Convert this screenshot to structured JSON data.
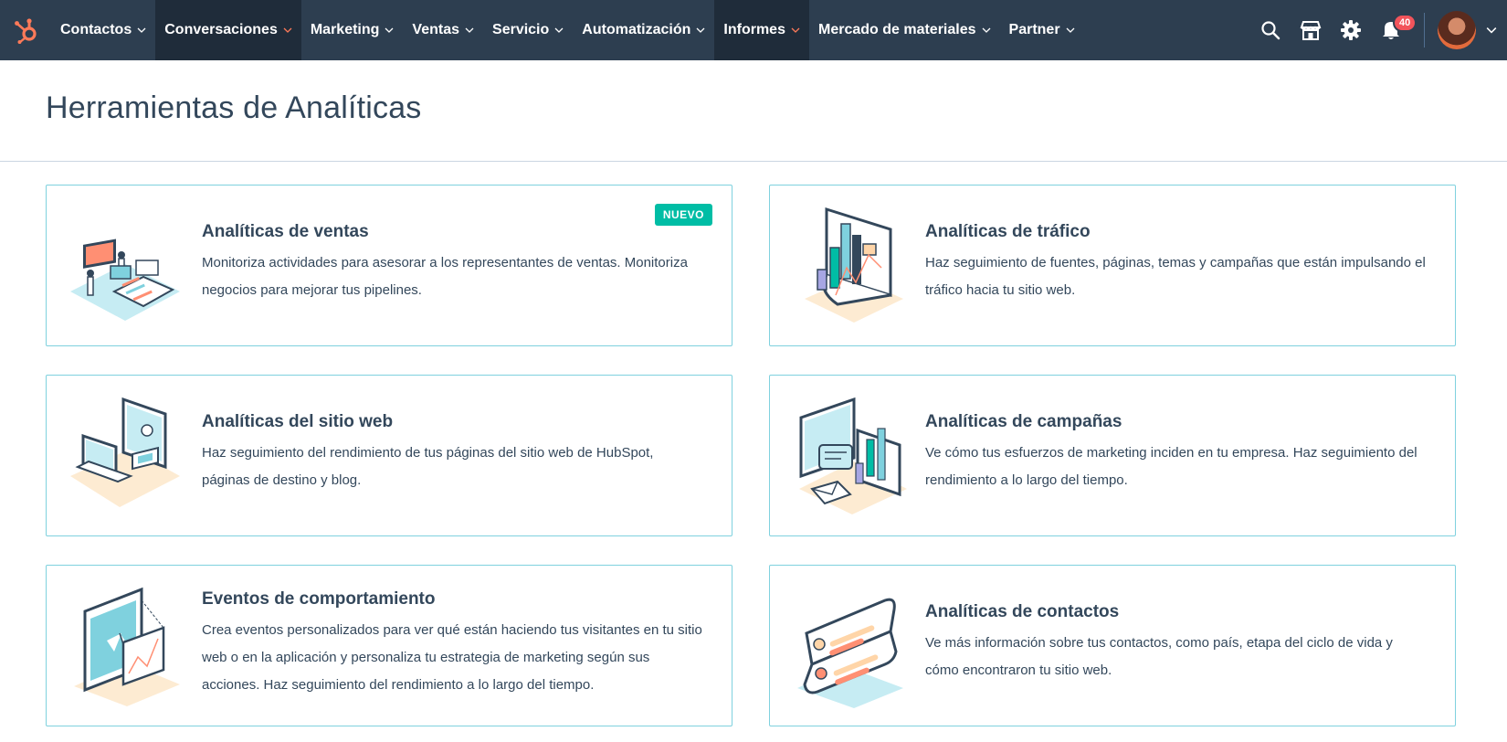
{
  "nav": {
    "logo_icon": "hubspot-sprocket-icon",
    "items": [
      {
        "label": "Contactos",
        "active": false
      },
      {
        "label": "Conversaciones",
        "active": true
      },
      {
        "label": "Marketing",
        "active": false
      },
      {
        "label": "Ventas",
        "active": false
      },
      {
        "label": "Servicio",
        "active": false
      },
      {
        "label": "Automatización",
        "active": false
      },
      {
        "label": "Informes",
        "active": true
      },
      {
        "label": "Mercado de materiales",
        "active": false
      },
      {
        "label": "Partner",
        "active": false
      }
    ],
    "notifications_count": "40",
    "colors": {
      "bar": "#2d3e50",
      "active": "#1f2c3a",
      "accent": "#ff7a59",
      "badge": "#f2545b"
    }
  },
  "page": {
    "title": "Herramientas de Analíticas"
  },
  "cards": [
    {
      "title": "Analíticas de ventas",
      "description": "Monitoriza actividades para asesorar a los representantes de ventas. Monitoriza negocios para mejorar tus pipelines.",
      "badge": "NUEVO",
      "icon": "sales-analytics-illustration"
    },
    {
      "title": "Analíticas de tráfico",
      "description": "Haz seguimiento de fuentes, páginas, temas y campañas que están impulsando el tráfico hacia tu sitio web.",
      "icon": "traffic-analytics-illustration"
    },
    {
      "title": "Analíticas del sitio web",
      "description": "Haz seguimiento del rendimiento de tus páginas del sitio web de HubSpot, páginas de destino y blog.",
      "icon": "website-analytics-illustration"
    },
    {
      "title": "Analíticas de campañas",
      "description": "Ve cómo tus esfuerzos de marketing inciden en tu empresa. Haz seguimiento del rendimiento a lo largo del tiempo.",
      "icon": "campaign-analytics-illustration"
    },
    {
      "title": "Eventos de comportamiento",
      "description": "Crea eventos personalizados para ver qué están haciendo tus visitantes en tu sitio web o en la aplicación y personaliza tu estrategia de marketing según sus acciones. Haz seguimiento del rendimiento a lo largo del tiempo.",
      "icon": "behavioral-events-illustration"
    },
    {
      "title": "Analíticas de contactos",
      "description": "Ve más información sobre tus contactos, como país, etapa del ciclo de vida y cómo encontraron tu sitio web.",
      "icon": "contact-analytics-illustration"
    }
  ]
}
